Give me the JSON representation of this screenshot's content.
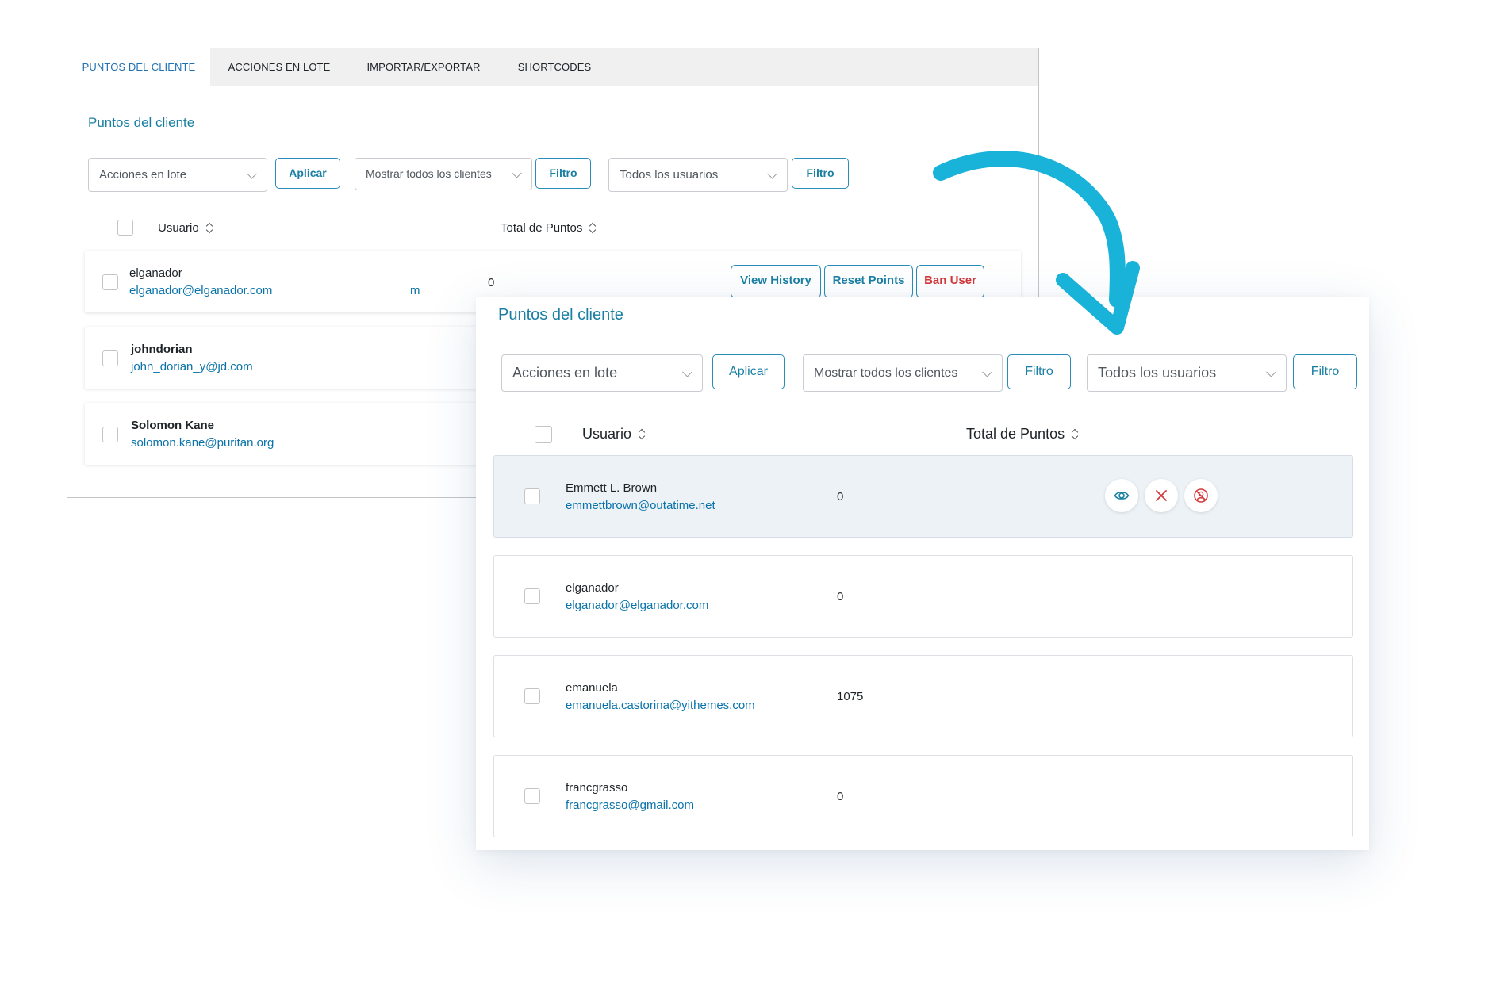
{
  "old_panel": {
    "tabs": [
      {
        "label": "PUNTOS DEL CLIENTE",
        "active": true
      },
      {
        "label": "ACCIONES EN LOTE",
        "active": false
      },
      {
        "label": "IMPORTAR/EXPORTAR",
        "active": false
      },
      {
        "label": "SHORTCODES",
        "active": false
      }
    ],
    "title": "Puntos del cliente",
    "filters": {
      "bulk_select": "Acciones en lote",
      "apply_button": "Aplicar",
      "customers_select": "Mostrar todos los clientes",
      "filter_button_1": "Filtro",
      "users_select": "Todos los usuarios",
      "filter_button_2": "Filtro"
    },
    "columns": {
      "user": "Usuario",
      "points": "Total de Puntos"
    },
    "rows": [
      {
        "name": "elganador",
        "email": "elganador@elganador.com",
        "extra": "m",
        "points": "0"
      },
      {
        "name": "johndorian",
        "email": "john_dorian_y@jd.com"
      },
      {
        "name": "Solomon Kane",
        "email": "solomon.kane@puritan.org"
      }
    ],
    "row_actions": {
      "view_history": "View History",
      "reset_points": "Reset Points",
      "ban_user": "Ban User"
    }
  },
  "new_panel": {
    "title": "Puntos del cliente",
    "filters": {
      "bulk_select": "Acciones en lote",
      "apply_button": "Aplicar",
      "customers_select": "Mostrar todos los clientes",
      "filter_button_1": "Filtro",
      "users_select": "Todos los usuarios",
      "filter_button_2": "Filtro"
    },
    "columns": {
      "user": "Usuario",
      "points": "Total de Puntos"
    },
    "rows": [
      {
        "name": "Emmett L. Brown",
        "email": "emmettbrown@outatime.net",
        "points": "0"
      },
      {
        "name": "elganador",
        "email": "elganador@elganador.com",
        "points": "0"
      },
      {
        "name": "emanuela",
        "email": "emanuela.castorina@yithemes.com",
        "points": "1075"
      },
      {
        "name": "francgrasso",
        "email": "francgrasso@gmail.com",
        "points": "0"
      }
    ],
    "row_action_icons": [
      "eye-icon",
      "close-icon",
      "ban-icon"
    ]
  },
  "colors": {
    "accent": "#1a7fa3",
    "link": "#0a73aa",
    "danger": "#d63638",
    "arrow": "#19b3d9"
  }
}
